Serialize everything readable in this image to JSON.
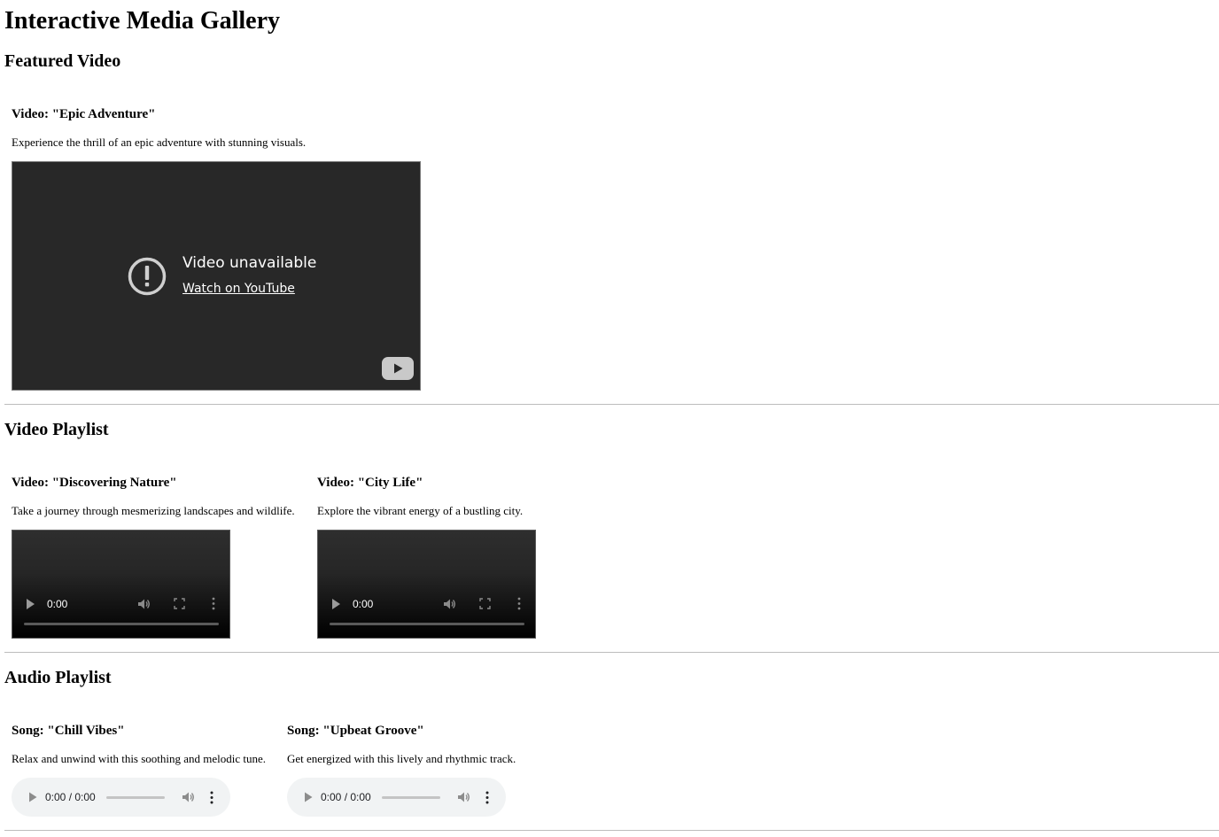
{
  "page": {
    "title": "Interactive Media Gallery"
  },
  "featured": {
    "heading": "Featured Video",
    "video": {
      "title": "Video: \"Epic Adventure\"",
      "description": "Experience the thrill of an epic adventure with stunning visuals.",
      "embed_message": "Video unavailable",
      "embed_link": "Watch on YouTube",
      "icons": {
        "alert": "alert-circle-icon",
        "logo": "youtube-logo-icon"
      }
    }
  },
  "video_playlist": {
    "heading": "Video Playlist",
    "items": [
      {
        "title": "Video: \"Discovering Nature\"",
        "description": "Take a journey through mesmerizing landscapes and wildlife.",
        "time": "0:00"
      },
      {
        "title": "Video: \"City Life\"",
        "description": "Explore the vibrant energy of a bustling city.",
        "time": "0:00"
      }
    ],
    "controls": {
      "icons": [
        "play-icon",
        "volume-icon",
        "fullscreen-icon",
        "more-options-icon"
      ]
    }
  },
  "audio_playlist": {
    "heading": "Audio Playlist",
    "items": [
      {
        "title": "Song: \"Chill Vibes\"",
        "description": "Relax and unwind with this soothing and melodic tune.",
        "time": "0:00 / 0:00"
      },
      {
        "title": "Song: \"Upbeat Groove\"",
        "description": "Get energized with this lively and rhythmic track.",
        "time": "0:00 / 0:00"
      }
    ],
    "controls": {
      "icons": [
        "play-icon",
        "volume-icon",
        "more-options-icon"
      ]
    }
  },
  "colors": {
    "embed_background": "#282828",
    "video_gradient_end": "#000000",
    "audio_background": "#f1f3f4",
    "divider": "#bdbdbd"
  }
}
